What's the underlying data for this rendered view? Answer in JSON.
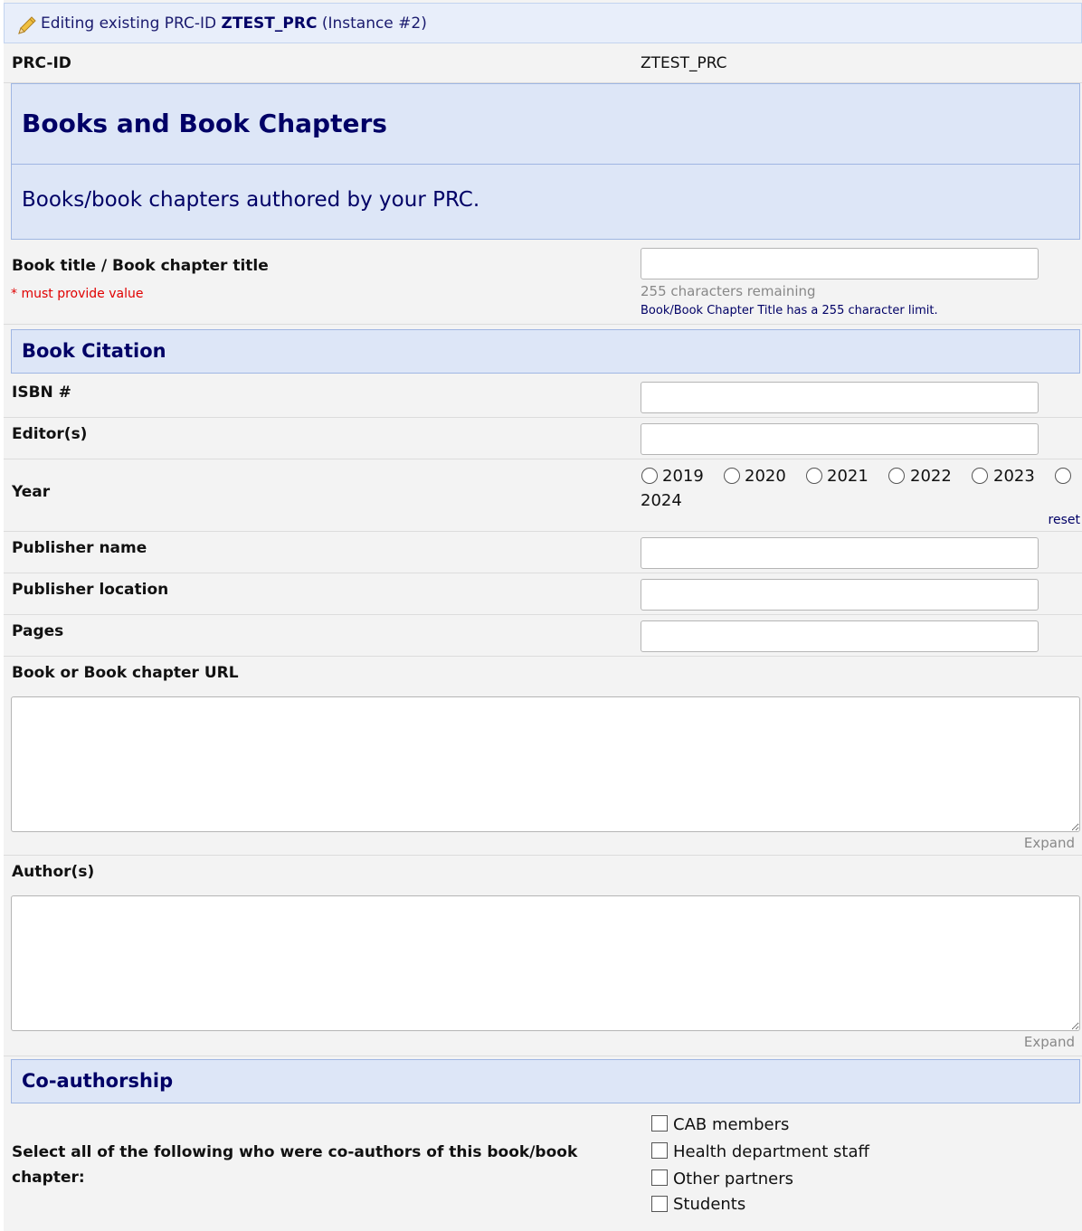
{
  "banner": {
    "prefix": "Editing existing PRC-ID",
    "record_id": "ZTEST_PRC",
    "instance": "(Instance #2)"
  },
  "prc_id": {
    "label": "PRC-ID",
    "value": "ZTEST_PRC"
  },
  "section_main": {
    "title": "Books and Book Chapters",
    "description": "Books/book chapters authored by your PRC."
  },
  "book_title": {
    "label": "Book title / Book chapter title",
    "required_note": "* must provide value",
    "value": "",
    "remaining": "255 characters remaining",
    "limit_note": "Book/Book Chapter Title has a 255 character limit."
  },
  "section_citation": {
    "title": "Book Citation"
  },
  "isbn": {
    "label": "ISBN #",
    "value": ""
  },
  "editors": {
    "label": "Editor(s)",
    "value": ""
  },
  "year": {
    "label": "Year",
    "options": [
      "2019",
      "2020",
      "2021",
      "2022",
      "2023",
      "2024"
    ],
    "reset_label": "reset"
  },
  "publisher_name": {
    "label": "Publisher name",
    "value": ""
  },
  "publisher_location": {
    "label": "Publisher location",
    "value": ""
  },
  "pages": {
    "label": "Pages",
    "value": ""
  },
  "url": {
    "label": "Book or Book chapter URL",
    "value": "",
    "expand_label": "Expand"
  },
  "authors": {
    "label": "Author(s)",
    "value": "",
    "expand_label": "Expand"
  },
  "section_coauthor": {
    "title": "Co-authorship"
  },
  "coauthors": {
    "label_line1": "Select all of the following who were co-authors of this book/book",
    "label_line2": "chapter:",
    "options": [
      "CAB members",
      "Health department staff",
      "Other partners",
      "Students"
    ]
  }
}
